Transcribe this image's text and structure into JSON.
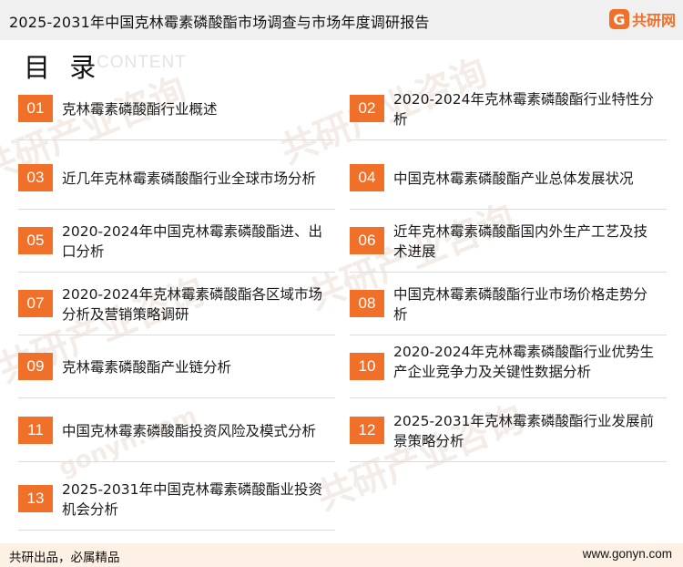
{
  "header": {
    "title": "2025-2031年中国克林霉素磷酸酯市场调查与市场年度调研报告",
    "logo_mark": "G",
    "logo_text": "共研网"
  },
  "toc": {
    "heading": "目 录",
    "subheading": "CONTENT",
    "items": [
      {
        "num": "01",
        "label": "克林霉素磷酸酯行业概述"
      },
      {
        "num": "02",
        "label": "2020-2024年克林霉素磷酸酯行业特性分析"
      },
      {
        "num": "03",
        "label": "近几年克林霉素磷酸酯行业全球市场分析"
      },
      {
        "num": "04",
        "label": "中国克林霉素磷酸酯产业总体发展状况"
      },
      {
        "num": "05",
        "label": "2020-2024年中国克林霉素磷酸酯进、出口分析"
      },
      {
        "num": "06",
        "label": "近年克林霉素磷酸酯国内外生产工艺及技术进展"
      },
      {
        "num": "07",
        "label": "2020-2024年克林霉素磷酸酯各区域市场分析及营销策略调研"
      },
      {
        "num": "08",
        "label": "中国克林霉素磷酸酯行业市场价格走势分析"
      },
      {
        "num": "09",
        "label": "克林霉素磷酸酯产业链分析"
      },
      {
        "num": "10",
        "label": "2020-2024年克林霉素磷酸酯行业优势生产企业竞争力及关键性数据分析"
      },
      {
        "num": "11",
        "label": "中国克林霉素磷酸酯投资风险及模式分析"
      },
      {
        "num": "12",
        "label": "2025-2031年克林霉素磷酸酯行业发展前景策略分析"
      },
      {
        "num": "13",
        "label": "2025-2031年中国克林霉素磷酸酯业投资机会分析"
      }
    ]
  },
  "watermark": {
    "text": "共研产业咨询",
    "url_text": "gonyn.com"
  },
  "footer": {
    "slogan": "共研出品，必属精品",
    "website": "www.gonyn.com"
  },
  "colors": {
    "accent": "#f0702a",
    "footer_bg": "#fdf0e5",
    "header_bg": "#f0f0f0"
  }
}
